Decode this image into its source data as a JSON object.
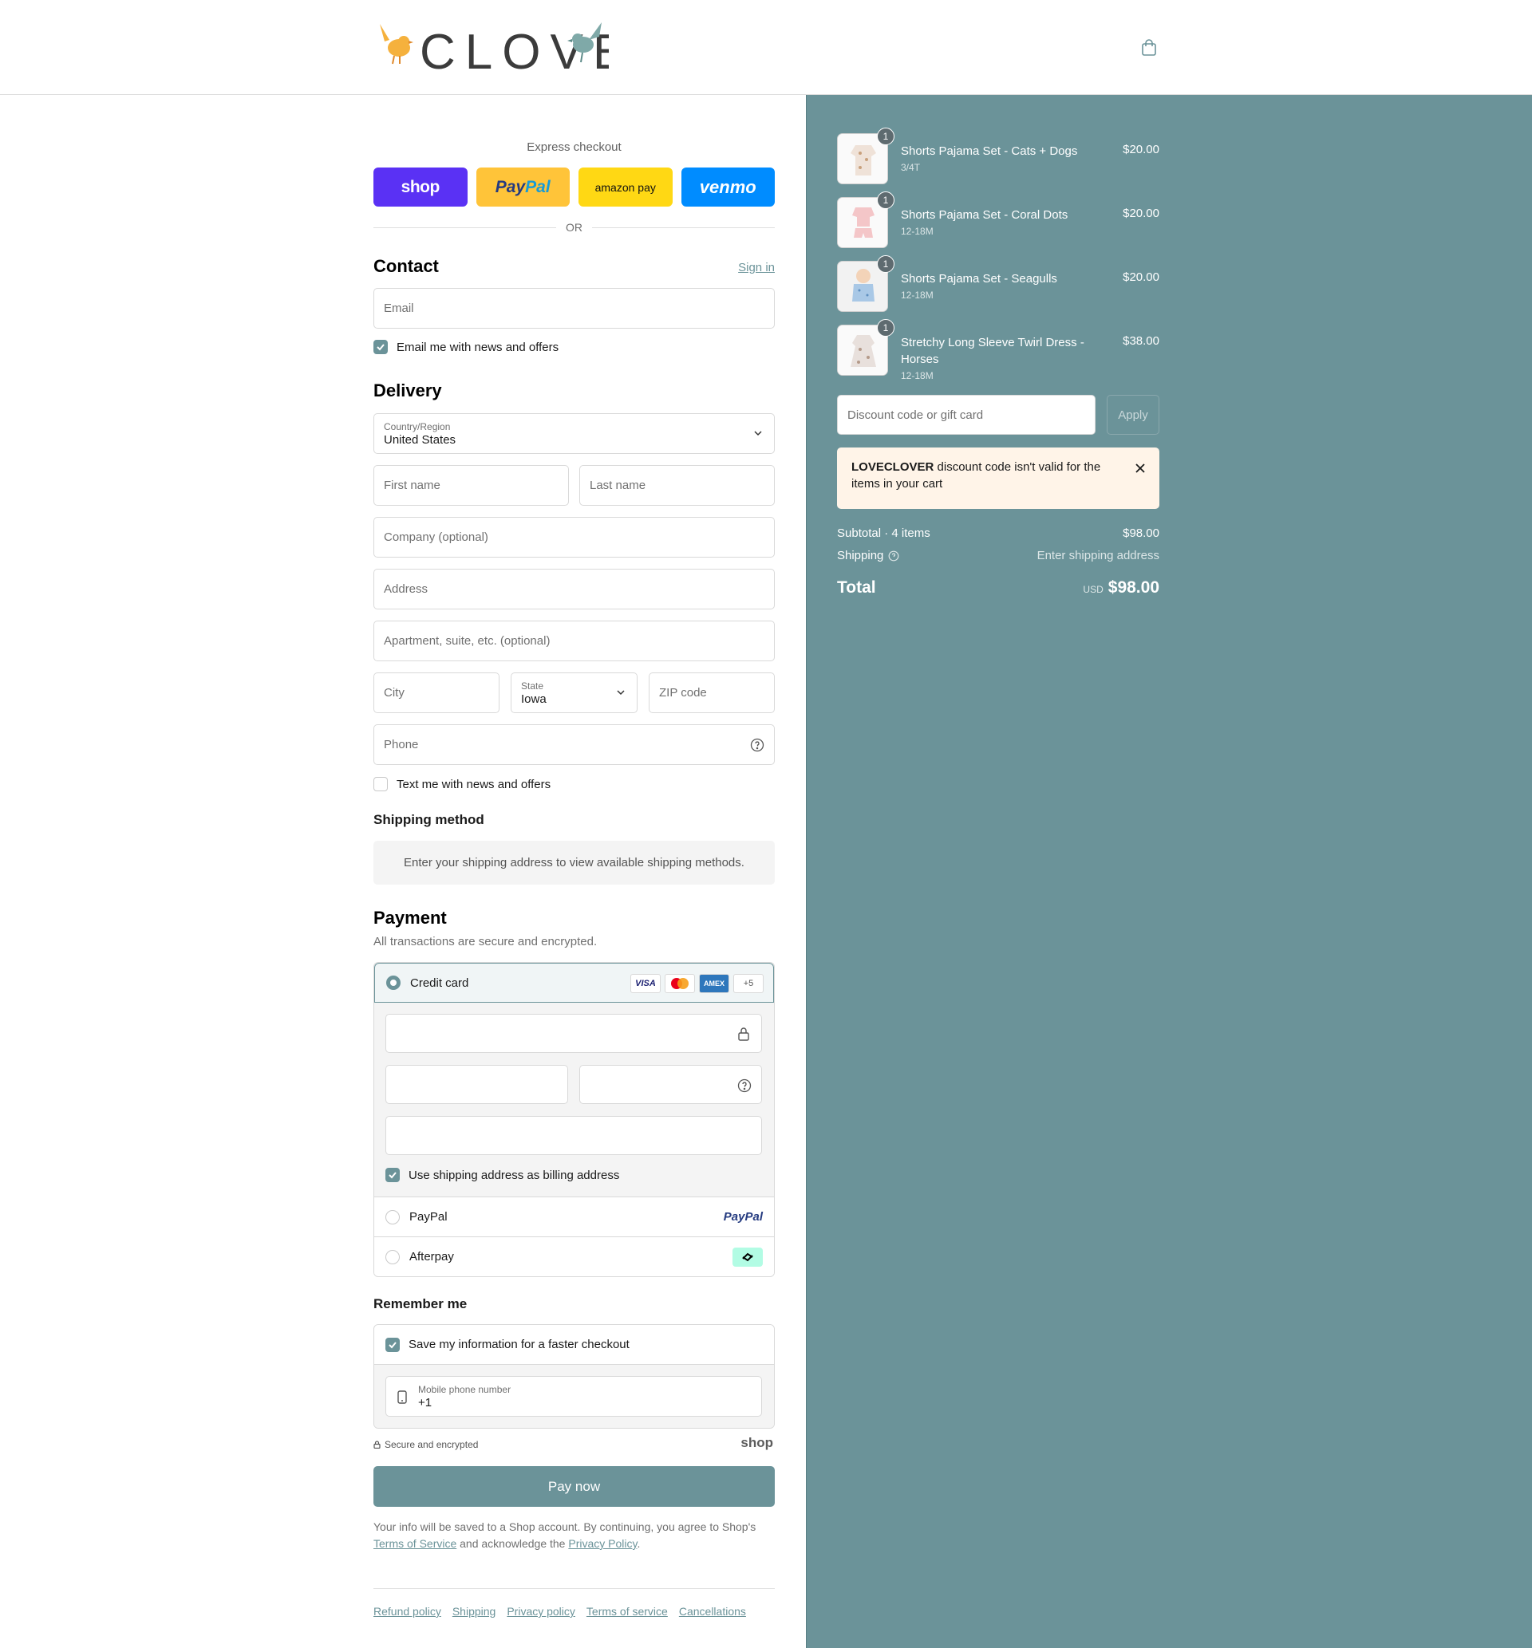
{
  "brand": {
    "name": "CLOVER"
  },
  "express": {
    "label": "Express checkout",
    "buttons": [
      "shop",
      "PayPal",
      "amazon pay",
      "venmo"
    ],
    "or": "OR"
  },
  "contact": {
    "heading": "Contact",
    "sign_in": "Sign in",
    "email_placeholder": "Email",
    "news_label": "Email me with news and offers",
    "news_checked": true
  },
  "delivery": {
    "heading": "Delivery",
    "country_label": "Country/Region",
    "country_value": "United States",
    "first_name": "First name",
    "last_name": "Last name",
    "company": "Company (optional)",
    "address": "Address",
    "apartment": "Apartment, suite, etc. (optional)",
    "city": "City",
    "state_label": "State",
    "state_value": "Iowa",
    "zip": "ZIP code",
    "phone": "Phone",
    "text_label": "Text me with news and offers",
    "text_checked": false
  },
  "shipping_method": {
    "heading": "Shipping method",
    "message": "Enter your shipping address to view available shipping methods."
  },
  "payment": {
    "heading": "Payment",
    "subtitle": "All transactions are secure and encrypted.",
    "credit_card": "Credit card",
    "card_logos": [
      "VISA",
      "mastercard",
      "AMEX",
      "+5"
    ],
    "billing_label": "Use shipping address as billing address",
    "paypal": "PayPal",
    "paypal_logo": "PayPal",
    "afterpay": "Afterpay"
  },
  "remember": {
    "heading": "Remember me",
    "save_label": "Save my information for a faster checkout",
    "phone_label": "Mobile phone number",
    "phone_value": "+1",
    "secure": "Secure and encrypted",
    "shop_logo": "shop"
  },
  "pay_now": "Pay now",
  "terms": {
    "text_1": "Your info will be saved to a Shop account. By continuing, you agree to Shop's",
    "tos": "Terms of Service",
    "text_2": "and acknowledge the",
    "privacy": "Privacy Policy",
    "text_3": "."
  },
  "footer_links": [
    "Refund policy",
    "Shipping",
    "Privacy policy",
    "Terms of service",
    "Cancellations"
  ],
  "cart": {
    "items": [
      {
        "name": "Shorts Pajama Set - Cats + Dogs",
        "variant": "3/4T",
        "price": "$20.00",
        "qty": "1"
      },
      {
        "name": "Shorts Pajama Set - Coral Dots",
        "variant": "12-18M",
        "price": "$20.00",
        "qty": "1"
      },
      {
        "name": "Shorts Pajama Set - Seagulls",
        "variant": "12-18M",
        "price": "$20.00",
        "qty": "1"
      },
      {
        "name": "Stretchy Long Sleeve Twirl Dress - Horses",
        "variant": "12-18M",
        "price": "$38.00",
        "qty": "1"
      }
    ],
    "discount_placeholder": "Discount code or gift card",
    "apply": "Apply",
    "alert_code": "LOVECLOVER",
    "alert_text": "discount code isn't valid for the items in your cart",
    "subtotal_label": "Subtotal · 4 items",
    "subtotal": "$98.00",
    "shipping_label": "Shipping",
    "shipping_value": "Enter shipping address",
    "total_label": "Total",
    "currency": "USD",
    "total": "$98.00"
  },
  "colors": {
    "accent": "#6b9399",
    "shop_purple": "#5a31f4",
    "paypal_yellow": "#ffc439",
    "amazon_yellow": "#ffd814",
    "venmo_blue": "#008cff",
    "alert_bg": "#fff4e8"
  }
}
